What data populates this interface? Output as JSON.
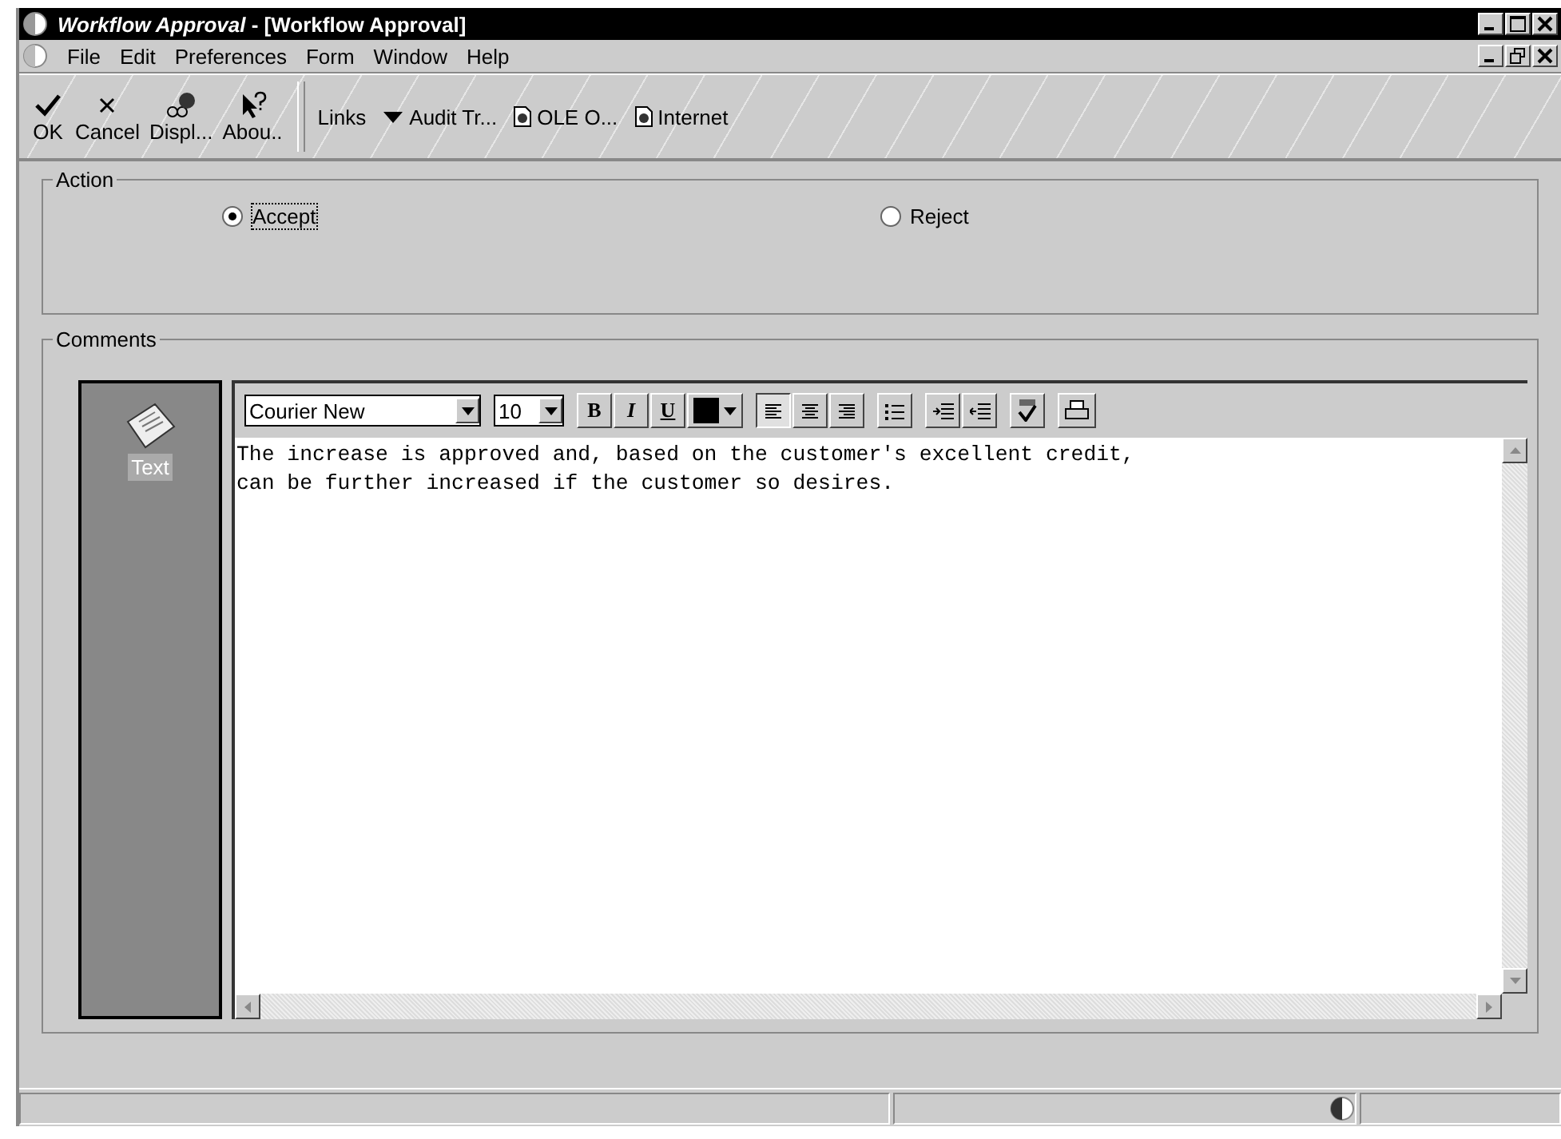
{
  "window": {
    "title": "*Workflow Approval*  - [Workflow Approval]"
  },
  "menu": [
    "File",
    "Edit",
    "Preferences",
    "Form",
    "Window",
    "Help"
  ],
  "toolbar": [
    {
      "kind": "ok",
      "label": "OK"
    },
    {
      "kind": "cancel",
      "label": "Cancel"
    },
    {
      "kind": "display",
      "label": "Displ..."
    },
    {
      "kind": "about",
      "label": "Abou.."
    }
  ],
  "links": [
    {
      "kind": "label",
      "label": "Links"
    },
    {
      "kind": "dropdown",
      "label": "Audit Tr..."
    },
    {
      "kind": "doc",
      "label": "OLE O..."
    },
    {
      "kind": "doc",
      "label": "Internet"
    }
  ],
  "action": {
    "title": "Action",
    "options": [
      {
        "label": "Accept",
        "selected": true
      },
      {
        "label": "Reject",
        "selected": false
      }
    ]
  },
  "comments": {
    "title": "Comments",
    "side_item": {
      "label": "Text",
      "selected": true
    },
    "font": "Courier New",
    "size": "10",
    "format": [
      {
        "kind": "bold",
        "label": "B"
      },
      {
        "kind": "italic",
        "label": "I"
      },
      {
        "kind": "underline",
        "label": "U"
      }
    ],
    "align": [
      {
        "kind": "left",
        "selected": true
      },
      {
        "kind": "center",
        "selected": false
      },
      {
        "kind": "right",
        "selected": false
      }
    ],
    "text": "The increase is approved and, based on the customer's excellent credit,\ncan be further increased if the customer so desires."
  }
}
